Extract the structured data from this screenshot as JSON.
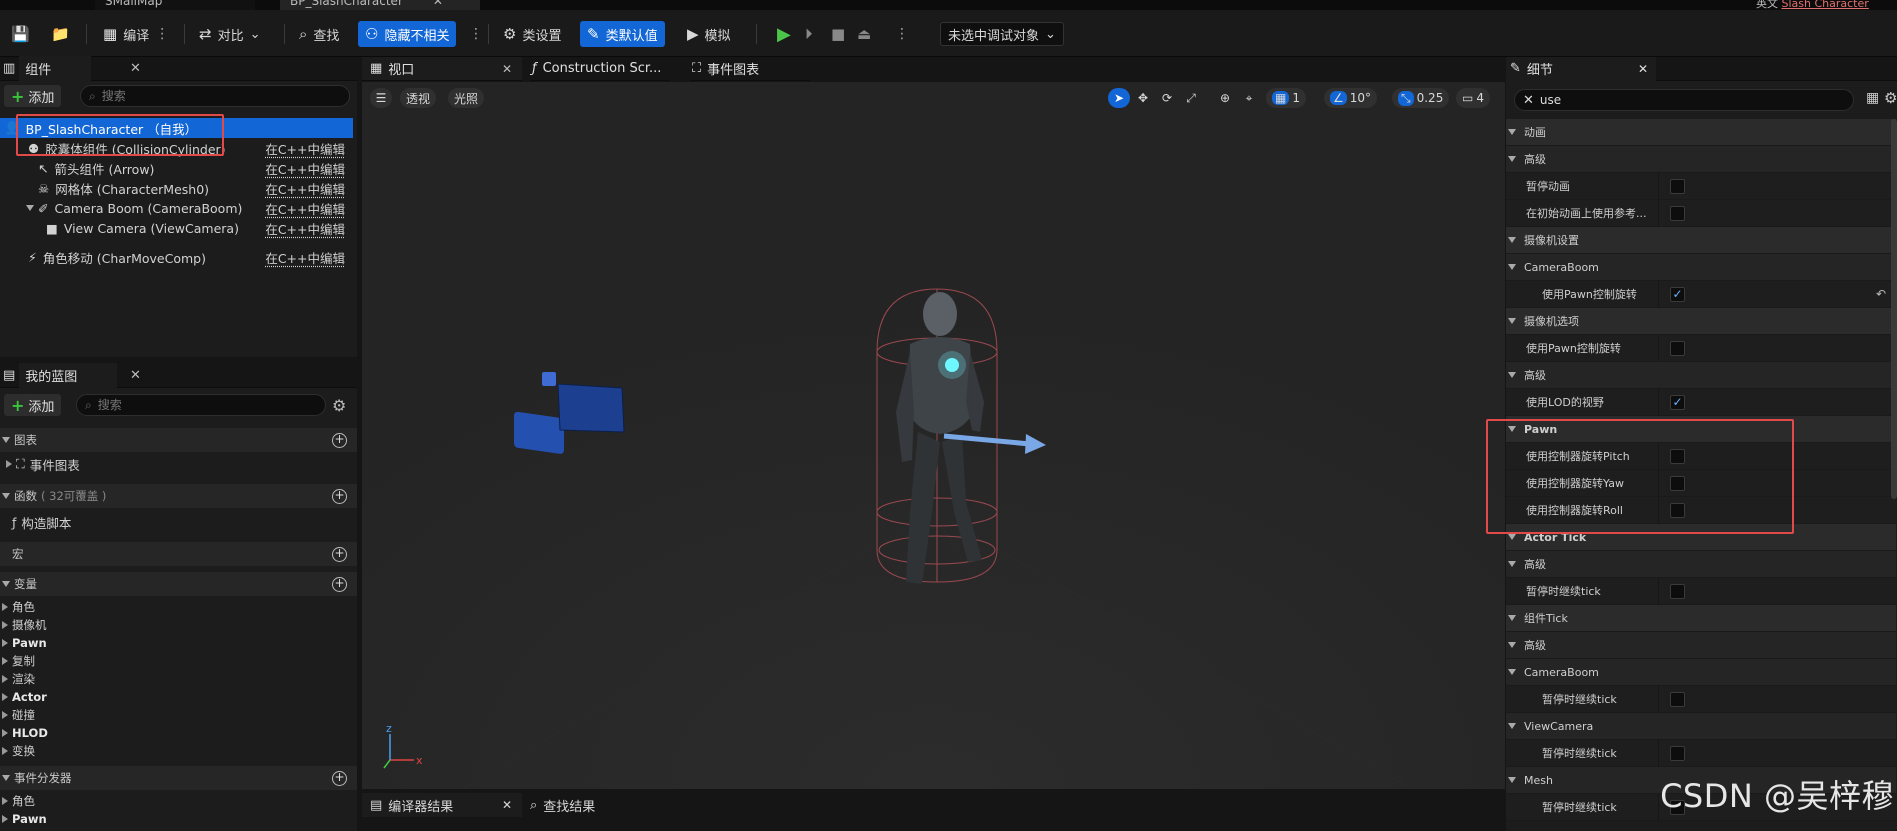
{
  "window": {
    "tab_map": "SMallMap",
    "tab_bp": "BP_SlashCharacter",
    "tab_right": "Slash Character",
    "tab_right_prefix": "英文"
  },
  "toolbar": {
    "compile": "编译",
    "diff": "对比",
    "find": "查找",
    "hide_unrelated": "隐藏不相关",
    "class_settings": "类设置",
    "class_defaults": "类默认值",
    "simulate": "模拟",
    "debug_target": "未选中调试对象"
  },
  "components": {
    "tab": "组件",
    "add": "添加",
    "search_placeholder": "搜索",
    "root": "BP_SlashCharacter （自我）",
    "items": [
      {
        "label": "胶囊体组件 (CollisionCylinder)",
        "edit": "在C++中编辑"
      },
      {
        "label": "箭头组件 (Arrow)",
        "edit": "在C++中编辑"
      },
      {
        "label": "网格体 (CharacterMesh0)",
        "edit": "在C++中编辑"
      },
      {
        "label": "Camera Boom (CameraBoom)",
        "edit": "在C++中编辑"
      },
      {
        "label": "View Camera (ViewCamera)",
        "edit": "在C++中编辑"
      },
      {
        "label": "角色移动 (CharMoveComp)",
        "edit": "在C++中编辑"
      }
    ]
  },
  "myblueprint": {
    "tab": "我的蓝图",
    "add": "添加",
    "search_placeholder": "搜索",
    "graphs": "图表",
    "event_graph": "事件图表",
    "functions": "函数",
    "functions_note": "( 32可覆盖 )",
    "construction": "构造脚本",
    "macros": "宏",
    "variables": "变量",
    "var_items": [
      "角色",
      "摄像机",
      "Pawn",
      "复制",
      "渲染",
      "Actor",
      "碰撞",
      "HLOD",
      "变换"
    ],
    "dispatchers": "事件分发器",
    "disp_items": [
      "角色",
      "Pawn"
    ]
  },
  "viewport": {
    "tabs": [
      "视口",
      "Construction Scr...",
      "事件图表"
    ],
    "perspective": "透视",
    "lighting": "光照",
    "grid": "1",
    "angle": "10°",
    "scale": "0.25",
    "camspeed": "4"
  },
  "details": {
    "tab": "细节",
    "search_value": "use",
    "rows": [
      {
        "t": "cat",
        "label": "动画"
      },
      {
        "t": "sub",
        "label": "高级"
      },
      {
        "t": "prop",
        "label": "暂停动画",
        "checked": false
      },
      {
        "t": "prop",
        "label": "在初始动画上使用参考...",
        "checked": false
      },
      {
        "t": "cat",
        "label": "摄像机设置"
      },
      {
        "t": "sub",
        "label": "CameraBoom"
      },
      {
        "t": "prop2",
        "label": "使用Pawn控制旋转",
        "checked": true
      },
      {
        "t": "cat",
        "label": "摄像机选项"
      },
      {
        "t": "prop",
        "label": "使用Pawn控制旋转",
        "checked": false
      },
      {
        "t": "sub",
        "label": "高级"
      },
      {
        "t": "prop",
        "label": "使用LOD的视野",
        "checked": true
      },
      {
        "t": "cat",
        "label": "Pawn"
      },
      {
        "t": "prop",
        "label": "使用控制器旋转Pitch",
        "checked": false
      },
      {
        "t": "prop",
        "label": "使用控制器旋转Yaw",
        "checked": false
      },
      {
        "t": "prop",
        "label": "使用控制器旋转Roll",
        "checked": false
      },
      {
        "t": "cat",
        "label": "Actor Tick"
      },
      {
        "t": "sub",
        "label": "高级"
      },
      {
        "t": "prop",
        "label": "暂停时继续tick",
        "checked": false
      },
      {
        "t": "cat",
        "label": "组件Tick"
      },
      {
        "t": "sub",
        "label": "高级"
      },
      {
        "t": "sub",
        "label": "CameraBoom"
      },
      {
        "t": "prop2",
        "label": "暂停时继续tick",
        "checked": false
      },
      {
        "t": "sub",
        "label": "ViewCamera"
      },
      {
        "t": "prop2",
        "label": "暂停时继续tick",
        "checked": false
      },
      {
        "t": "sub",
        "label": "Mesh"
      },
      {
        "t": "prop2",
        "label": "暂停时继续tick",
        "checked": false
      }
    ]
  },
  "bottom": {
    "compiler_results": "编译器结果",
    "find_results": "查找结果"
  },
  "watermark": "CSDN @吴梓穆",
  "colors": {
    "accent": "#1266d6",
    "highlight": "#e24a4a",
    "add_green": "#39c43b"
  }
}
